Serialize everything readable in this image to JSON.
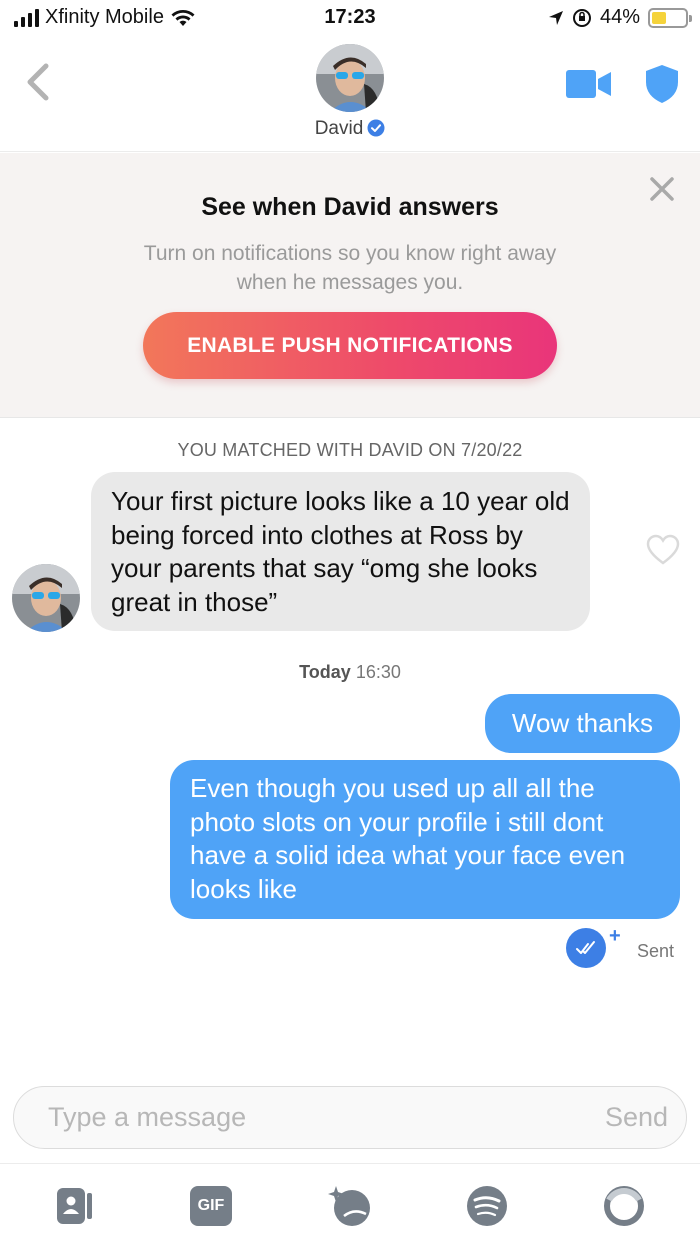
{
  "status_bar": {
    "carrier": "Xfinity Mobile",
    "time": "17:23",
    "battery": "44%",
    "battery_level": 0.44
  },
  "header": {
    "contact_name": "David"
  },
  "promo": {
    "title": "See when David answers",
    "text": "Turn on notifications so you know right away when he messages you.",
    "button_label": "ENABLE PUSH NOTIFICATIONS"
  },
  "chat": {
    "match_note": "YOU MATCHED WITH DAVID ON 7/20/22",
    "incoming": [
      {
        "text": "Your first picture looks like a 10 year old being forced into clothes at Ross by your parents that say “omg she looks great in those”"
      }
    ],
    "time_day": "Today",
    "time_clock": "16:30",
    "outgoing": [
      {
        "text": "Wow thanks"
      },
      {
        "text": "Even though you used up all all the photo slots on your profile i still dont have a solid idea what your face even looks like"
      }
    ],
    "sent_label": "Sent"
  },
  "composer": {
    "placeholder": "Type a message",
    "send_label": "Send"
  },
  "toolbar": {
    "gif_label": "GIF"
  },
  "colors": {
    "accent_blue": "#4fa3f7",
    "brand_gradient_start": "#f2775a",
    "brand_gradient_end": "#e9357a",
    "icon_grey": "#757e88"
  }
}
